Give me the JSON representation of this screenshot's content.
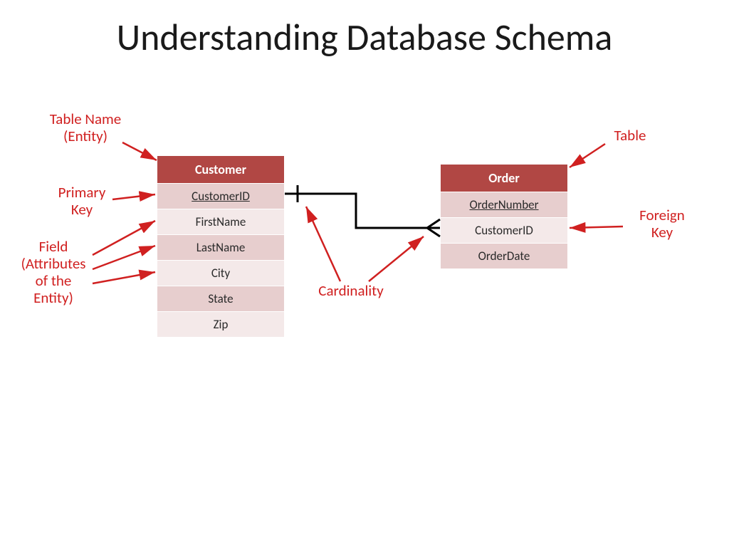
{
  "title": "Understanding Database Schema",
  "tables": {
    "customer": {
      "name": "Customer",
      "fields": [
        "CustomerID",
        "FirstName",
        "LastName",
        "City",
        "State",
        "Zip"
      ],
      "primaryKey": "CustomerID"
    },
    "order": {
      "name": "Order",
      "fields": [
        "OrderNumber",
        "CustomerID",
        "OrderDate"
      ],
      "primaryKey": "OrderNumber"
    }
  },
  "annotations": {
    "tableNameEntity1": "Table Name",
    "tableNameEntity2": "(Entity)",
    "primaryKey1": "Primary",
    "primaryKey2": "Key",
    "field1": "Field",
    "field2": "(Attributes",
    "field3": "of the",
    "field4": "Entity)",
    "cardinality": "Cardinality",
    "table": "Table",
    "foreignKey1": "Foreign",
    "foreignKey2": "Key"
  },
  "relationship": {
    "type": "one-to-many",
    "from": "Customer.CustomerID",
    "to": "Order.CustomerID"
  }
}
